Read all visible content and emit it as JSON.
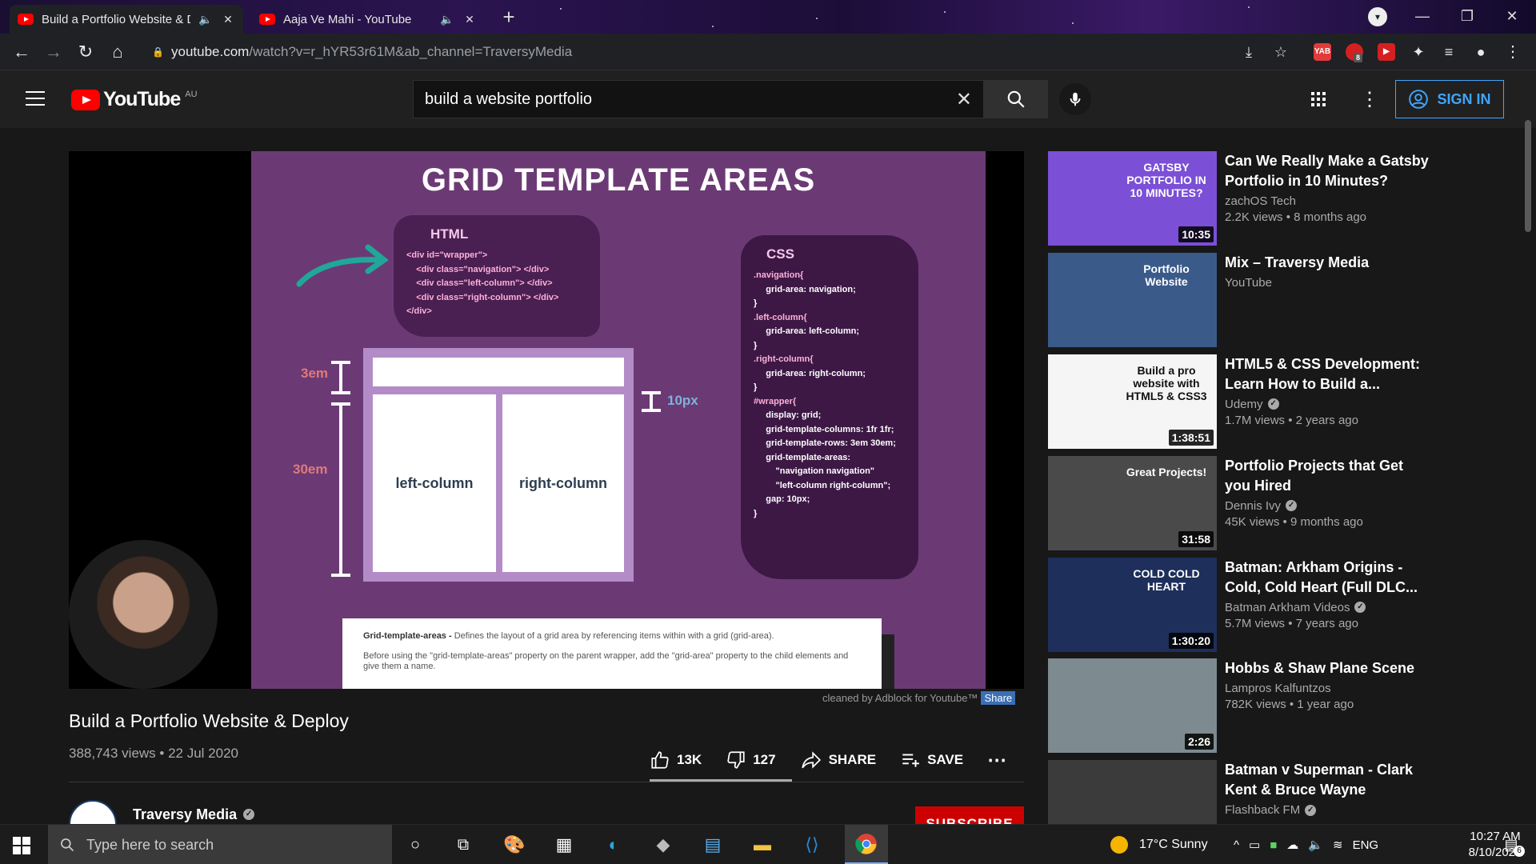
{
  "browser": {
    "tabs": [
      {
        "title": "Build a Portfolio Website & D",
        "active": true
      },
      {
        "title": "Aaja Ve Mahi - YouTube",
        "active": false
      }
    ],
    "url_host": "youtube.com",
    "url_path": "/watch?v=r_hYR53r61M&ab_channel=TraversyMedia",
    "ext_badge": "8",
    "ext_ab_label": "YAB"
  },
  "youtube": {
    "logo_text": "YouTube",
    "region": "AU",
    "search_value": "build a website portfolio",
    "sign_in": "SIGN IN"
  },
  "slide": {
    "title": "GRID TEMPLATE AREAS",
    "html_head": "HTML",
    "html_lines": [
      "<div id=\"wrapper\">",
      "    <div class=\"navigation\"> </div>",
      "    <div class=\"left-column\"> </div>",
      "    <div class=\"right-column\"> </div>",
      "</div>"
    ],
    "css_head": "CSS",
    "css_lines": [
      ".navigation{",
      "     grid-area: navigation;",
      "}",
      "",
      ".left-column{",
      "     grid-area: left-column;",
      "}",
      "",
      ".right-column{",
      "     grid-area: right-column;",
      "}",
      "",
      "#wrapper{",
      "     display: grid;",
      "     grid-template-columns: 1fr 1fr;",
      "     grid-template-rows: 3em 30em;",
      "     grid-template-areas:",
      "         \"navigation navigation\"",
      "         \"left-column right-column\";",
      "     gap: 10px;",
      "}"
    ],
    "nav1": "navigation",
    "nav2": "navigation",
    "left": "left-column",
    "right": "right-column",
    "dim_3em": "3em",
    "dim_30em": "30em",
    "dim_10px": "10px",
    "caption_bold": "Grid-template-areas -",
    "caption_line1": " Defines the layout of a grid area by referencing items within with a grid (grid-area).",
    "caption_line2": "Before using the \"grid-template-areas\" property on the parent wrapper, add the \"grid-area\" property to the child elements and give them a name."
  },
  "adblock": {
    "text": "cleaned by Adblock for Youtube™",
    "share": "Share"
  },
  "video": {
    "title": "Build a Portfolio Website & Deploy",
    "meta": "388,743 views • 22 Jul 2020",
    "likes": "13K",
    "dislikes": "127",
    "share": "SHARE",
    "save": "SAVE",
    "channel": "Traversy Media",
    "subscribe": "SUBSCRIBE"
  },
  "recommendations": [
    {
      "title": "Can We Really Make a Gatsby Portfolio in 10 Minutes?",
      "channel": "zachOS Tech",
      "meta": "2.2K views • 8 months ago",
      "duration": "10:35",
      "verified": false,
      "thumb_text": "GATSBY PORTFOLIO IN 10 MINUTES?",
      "thumb_color": "#7b4fd6"
    },
    {
      "title": "Mix – Traversy Media",
      "channel": "YouTube",
      "meta": "",
      "duration": "",
      "verified": false,
      "thumb_text": "Portfolio Website",
      "thumb_color": "#3a5a8a"
    },
    {
      "title": "HTML5 & CSS Development: Learn How to Build a...",
      "channel": "Udemy",
      "meta": "1.7M views • 2 years ago",
      "duration": "1:38:51",
      "verified": true,
      "thumb_text": "Build a pro website with HTML5 & CSS3",
      "thumb_color": "#f5f5f5"
    },
    {
      "title": "Portfolio Projects that Get you Hired",
      "channel": "Dennis Ivy",
      "meta": "45K views • 9 months ago",
      "duration": "31:58",
      "verified": true,
      "thumb_text": "Great Projects!",
      "thumb_color": "#4a4a4a"
    },
    {
      "title": "Batman: Arkham Origins - Cold, Cold Heart (Full DLC...",
      "channel": "Batman Arkham Videos",
      "meta": "5.7M views • 7 years ago",
      "duration": "1:30:20",
      "verified": true,
      "thumb_text": "COLD COLD HEART",
      "thumb_color": "#1d2f5a"
    },
    {
      "title": "Hobbs & Shaw Plane Scene",
      "channel": "Lampros Kalfuntzos",
      "meta": "782K views • 1 year ago",
      "duration": "2:26",
      "verified": false,
      "thumb_text": "",
      "thumb_color": "#7d8a8f"
    },
    {
      "title": "Batman v Superman - Clark Kent & Bruce Wayne",
      "channel": "Flashback FM",
      "meta": "",
      "duration": "",
      "verified": true,
      "thumb_text": "",
      "thumb_color": "#3b3b3b"
    }
  ],
  "taskbar": {
    "search_placeholder": "Type here to search",
    "weather": "17°C  Sunny",
    "lang": "ENG",
    "time": "10:27 AM",
    "date": "8/10/2021",
    "notif_count": "6"
  }
}
